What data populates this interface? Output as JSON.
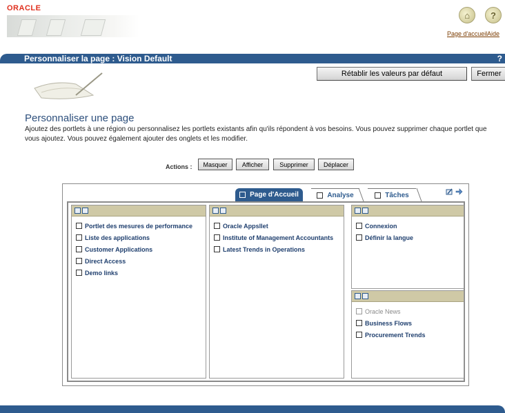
{
  "brand": {
    "logo_text": "ORACLE"
  },
  "global_links": {
    "home_label": "Page d'accueil",
    "help_label": "Aide"
  },
  "titlebar": {
    "title": "Personnaliser la page : Vision Default",
    "help_glyph": "?"
  },
  "header_buttons": {
    "restore_label": "Rétablir les valeurs par défaut",
    "close_label": "Fermer"
  },
  "page": {
    "heading": "Personnaliser une page",
    "description": "Ajoutez des portlets à une région ou personnalisez les portlets existants afin qu'ils répondent à vos besoins. Vous pouvez supprimer chaque portlet que vous ajoutez. Vous pouvez également ajouter des onglets et les modifier."
  },
  "actions": {
    "label": "Actions :",
    "hide": "Masquer",
    "show": "Afficher",
    "delete": "Supprimer",
    "move": "Déplacer"
  },
  "tabs": [
    {
      "label": "Page d'Accueil",
      "active": true
    },
    {
      "label": "Analyse",
      "active": false
    },
    {
      "label": "Tâches",
      "active": false
    }
  ],
  "regions": {
    "left": [
      "Portlet des mesures de performance",
      "Liste des applications",
      "Customer Applications",
      "Direct Access",
      "Demo links"
    ],
    "middle": [
      "Oracle Appsllet",
      "Institute of Management Accountants",
      "Latest Trends in Operations"
    ],
    "right_top": [
      "Connexion",
      "Définir la langue"
    ],
    "right_bottom": [
      {
        "label": "Oracle News",
        "disabled": true
      },
      {
        "label": "Business Flows",
        "disabled": false
      },
      {
        "label": "Procurement Trends",
        "disabled": false
      }
    ]
  },
  "icons": [
    "home-icon",
    "help-icon",
    "edit-layout-icon",
    "move-tabs-icon",
    "portlet-add-icon"
  ],
  "colors": {
    "brand_red": "#e0301e",
    "bar_blue": "#2e5b8e",
    "region_header": "#cfc9a6",
    "link_text": "#1f3f6e"
  }
}
